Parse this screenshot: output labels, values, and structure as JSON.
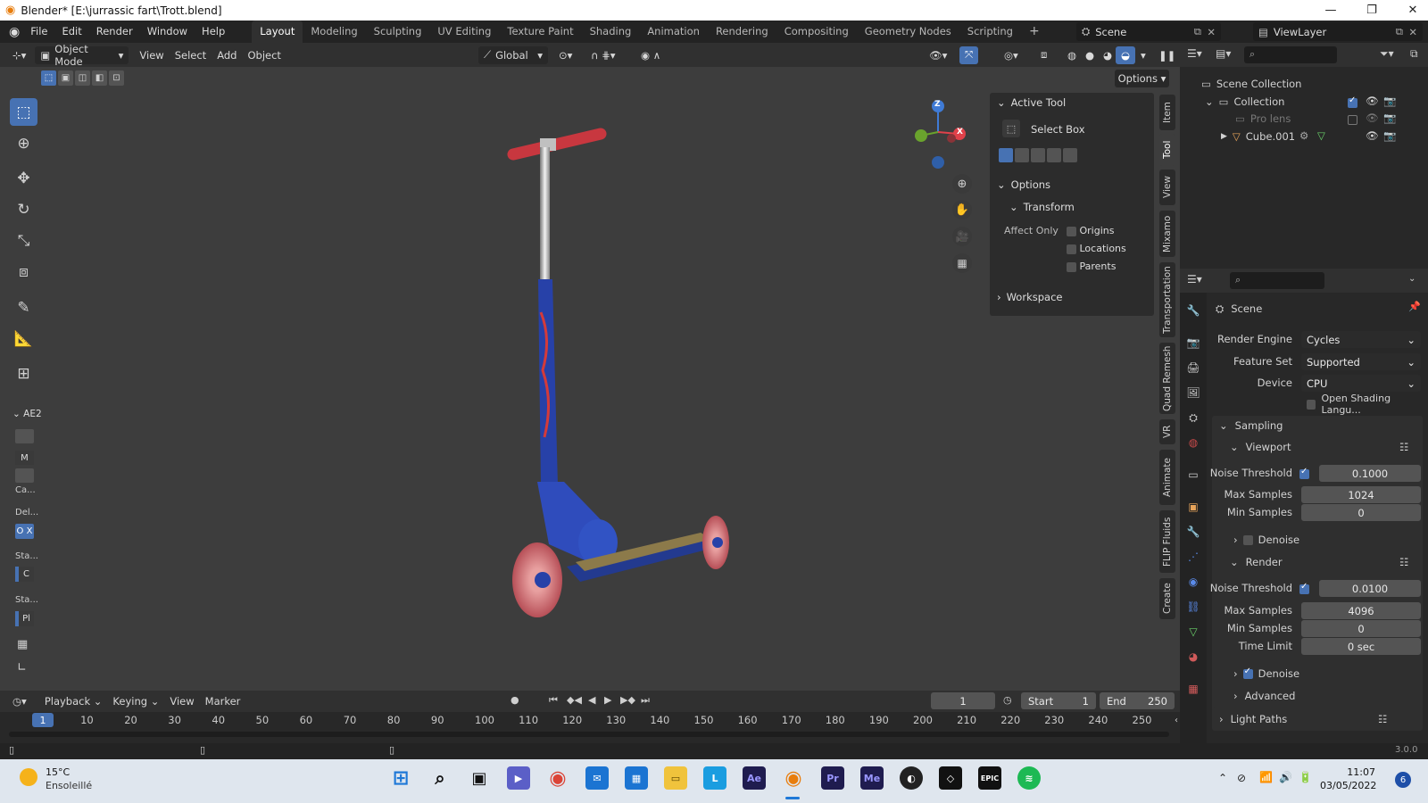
{
  "window": {
    "title": "Blender* [E:\\jurrassic fart\\Trott.blend]",
    "controls": [
      "—",
      "❐",
      "✕"
    ]
  },
  "topbar": {
    "menus": [
      "File",
      "Edit",
      "Render",
      "Window",
      "Help"
    ],
    "workspaces": [
      "Layout",
      "Modeling",
      "Sculpting",
      "UV Editing",
      "Texture Paint",
      "Shading",
      "Animation",
      "Rendering",
      "Compositing",
      "Geometry Nodes",
      "Scripting"
    ],
    "active_workspace": "Layout",
    "add_workspace": "+",
    "scene": "Scene",
    "view_layer": "ViewLayer"
  },
  "viewport_header": {
    "mode": "Object Mode",
    "menus": [
      "View",
      "Select",
      "Add",
      "Object"
    ],
    "orientation": "Global",
    "options_label": "Options"
  },
  "side_letters": {
    "section": "AE2",
    "items": [
      "M",
      "Ca...",
      "Del...",
      "O X",
      "Sta...",
      "C",
      "Sta...",
      "Pl"
    ]
  },
  "npanel": {
    "active_tool_label": "Active Tool",
    "tool_name": "Select Box",
    "options_label": "Options",
    "transform_label": "Transform",
    "affect_only_label": "Affect Only",
    "affect_items": [
      "Origins",
      "Locations",
      "Parents"
    ],
    "workspace_label": "Workspace",
    "tabs": [
      "Item",
      "Tool",
      "View",
      "Mixamo",
      "Transportation",
      "Quad Remesh",
      "VR",
      "Animate",
      "FLIP Fluids",
      "Create"
    ]
  },
  "gizmo": {
    "z": "Z",
    "x": "X"
  },
  "outliner": {
    "root": "Scene Collection",
    "collection": "Collection",
    "items": [
      "Pro lens",
      "Cube.001"
    ]
  },
  "properties": {
    "context": "Scene",
    "render_engine_label": "Render Engine",
    "render_engine": "Cycles",
    "feature_set_label": "Feature Set",
    "feature_set": "Supported",
    "device_label": "Device",
    "device": "CPU",
    "osl_label": "Open Shading Langu...",
    "sampling_label": "Sampling",
    "viewport_label": "Viewport",
    "noise_threshold_label": "Noise Threshold",
    "max_samples_label": "Max Samples",
    "min_samples_label": "Min Samples",
    "viewport_noise": "0.1000",
    "viewport_max": "1024",
    "viewport_min": "0",
    "denoise_label": "Denoise",
    "render_label": "Render",
    "render_noise": "0.0100",
    "render_max": "4096",
    "render_min": "0",
    "time_limit_label": "Time Limit",
    "time_limit": "0 sec",
    "advanced_label": "Advanced",
    "light_paths_label": "Light Paths"
  },
  "timeline": {
    "menus": [
      "Playback",
      "Keying",
      "View",
      "Marker"
    ],
    "current_frame": "1",
    "start_label": "Start",
    "start": "1",
    "end_label": "End",
    "end": "250",
    "ticks": [
      "10",
      "20",
      "30",
      "40",
      "50",
      "60",
      "70",
      "80",
      "90",
      "100",
      "110",
      "120",
      "130",
      "140",
      "150",
      "160",
      "170",
      "180",
      "190",
      "200",
      "210",
      "220",
      "230",
      "240",
      "250"
    ],
    "playhead": "1"
  },
  "statusbar": {
    "version": "3.0.0"
  },
  "taskbar": {
    "temperature": "15°C",
    "weather": "Ensoleillé",
    "time": "11:07",
    "date": "03/05/2022",
    "notifications": "6",
    "apps": [
      "windows",
      "search",
      "task-view",
      "teams",
      "chrome",
      "mail",
      "store",
      "explorer",
      "L",
      "Ae",
      "blender",
      "Pr",
      "Me",
      "obs",
      "unity",
      "EPIC",
      "spotify"
    ]
  },
  "colors": {
    "accent": "#4772b3",
    "scooter_blue": "#2741a8",
    "handle_red": "#c8373f"
  }
}
